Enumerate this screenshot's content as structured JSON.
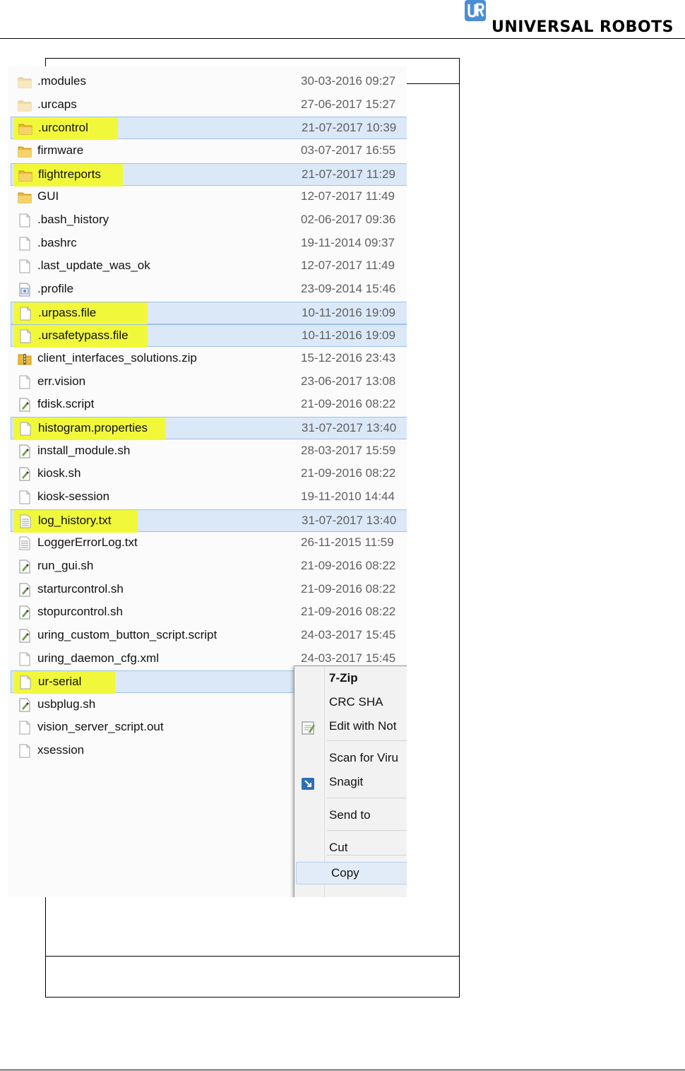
{
  "brand": {
    "name": "UNIVERSAL ROBOTS"
  },
  "files": [
    {
      "name": ".modules",
      "date": "30-03-2016 09:27",
      "icon": "folder-icon-faded",
      "selected": false,
      "highlighted": false
    },
    {
      "name": ".urcaps",
      "date": "27-06-2017 15:27",
      "icon": "folder-icon-faded",
      "selected": false,
      "highlighted": false
    },
    {
      "name": ".urcontrol",
      "date": "21-07-2017 10:39",
      "icon": "folder-icon",
      "selected": true,
      "highlighted": true
    },
    {
      "name": "firmware",
      "date": "03-07-2017 16:55",
      "icon": "folder-icon",
      "selected": false,
      "highlighted": false
    },
    {
      "name": "flightreports",
      "date": "21-07-2017 11:29",
      "icon": "folder-icon",
      "selected": true,
      "highlighted": true
    },
    {
      "name": "GUI",
      "date": "12-07-2017 11:49",
      "icon": "folder-icon",
      "selected": false,
      "highlighted": false
    },
    {
      "name": ".bash_history",
      "date": "02-06-2017 09:36",
      "icon": "blank-file-icon",
      "selected": false,
      "highlighted": false
    },
    {
      "name": ".bashrc",
      "date": "19-11-2014 09:37",
      "icon": "blank-file-icon",
      "selected": false,
      "highlighted": false
    },
    {
      "name": ".last_update_was_ok",
      "date": "12-07-2017 11:49",
      "icon": "blank-file-icon",
      "selected": false,
      "highlighted": false
    },
    {
      "name": ".profile",
      "date": "23-09-2014 15:46",
      "icon": "settings-file-icon",
      "selected": false,
      "highlighted": false
    },
    {
      "name": ".urpass.file",
      "date": "10-11-2016 19:09",
      "icon": "blank-file-icon",
      "selected": true,
      "highlighted": true
    },
    {
      "name": ".ursafetypass.file",
      "date": "10-11-2016 19:09",
      "icon": "blank-file-icon",
      "selected": true,
      "highlighted": true
    },
    {
      "name": "client_interfaces_solutions.zip",
      "date": "15-12-2016 23:43",
      "icon": "zip-file-icon",
      "selected": false,
      "highlighted": false
    },
    {
      "name": "err.vision",
      "date": "23-06-2017 13:08",
      "icon": "blank-file-icon",
      "selected": false,
      "highlighted": false
    },
    {
      "name": "fdisk.script",
      "date": "21-09-2016 08:22",
      "icon": "script-file-icon",
      "selected": false,
      "highlighted": false
    },
    {
      "name": "histogram.properties",
      "date": "31-07-2017 13:40",
      "icon": "blank-file-icon",
      "selected": true,
      "highlighted": true
    },
    {
      "name": "install_module.sh",
      "date": "28-03-2017 15:59",
      "icon": "script-file-icon",
      "selected": false,
      "highlighted": false
    },
    {
      "name": "kiosk.sh",
      "date": "21-09-2016 08:22",
      "icon": "script-file-icon",
      "selected": false,
      "highlighted": false
    },
    {
      "name": "kiosk-session",
      "date": "19-11-2010 14:44",
      "icon": "blank-file-icon",
      "selected": false,
      "highlighted": false
    },
    {
      "name": "log_history.txt",
      "date": "31-07-2017 13:40",
      "icon": "text-file-icon",
      "selected": true,
      "highlighted": true
    },
    {
      "name": "LoggerErrorLog.txt",
      "date": "26-11-2015 11:59",
      "icon": "text-file-icon",
      "selected": false,
      "highlighted": false
    },
    {
      "name": "run_gui.sh",
      "date": "21-09-2016 08:22",
      "icon": "script-file-icon",
      "selected": false,
      "highlighted": false
    },
    {
      "name": "starturcontrol.sh",
      "date": "21-09-2016 08:22",
      "icon": "script-file-icon",
      "selected": false,
      "highlighted": false
    },
    {
      "name": "stopurcontrol.sh",
      "date": "21-09-2016 08:22",
      "icon": "script-file-icon",
      "selected": false,
      "highlighted": false
    },
    {
      "name": "uring_custom_button_script.script",
      "date": "24-03-2017 15:45",
      "icon": "script-file-icon",
      "selected": false,
      "highlighted": false
    },
    {
      "name": "uring_daemon_cfg.xml",
      "date": "24-03-2017 15:45",
      "icon": "blank-file-icon",
      "selected": false,
      "highlighted": false
    },
    {
      "name": "ur-serial",
      "date": "",
      "icon": "blank-file-icon",
      "selected": true,
      "highlighted": true
    },
    {
      "name": "usbplug.sh",
      "date": "",
      "icon": "script-file-icon",
      "selected": false,
      "highlighted": false
    },
    {
      "name": "vision_server_script.out",
      "date": "",
      "icon": "blank-file-icon",
      "selected": false,
      "highlighted": false
    },
    {
      "name": "xsession",
      "date": "",
      "icon": "blank-file-icon",
      "selected": false,
      "highlighted": false
    }
  ],
  "context_menu": {
    "items": [
      {
        "label": "7-Zip",
        "bold": true,
        "icon": ""
      },
      {
        "label": "CRC SHA",
        "bold": false,
        "icon": ""
      },
      {
        "label": "Edit with Not",
        "bold": false,
        "icon": "notepad-icon"
      },
      {
        "label": "Scan for Viru",
        "bold": false,
        "icon": ""
      },
      {
        "label": "Snagit",
        "bold": false,
        "icon": "snagit-icon"
      },
      {
        "label": "Send to",
        "bold": false,
        "icon": ""
      },
      {
        "label": "Cut",
        "bold": false,
        "icon": ""
      },
      {
        "label": "Copy",
        "bold": false,
        "icon": "",
        "hover": true
      }
    ]
  },
  "colors": {
    "highlight": "#f1f83a",
    "selection": "#dbe8f7",
    "selection_border": "#9ec2ea"
  }
}
